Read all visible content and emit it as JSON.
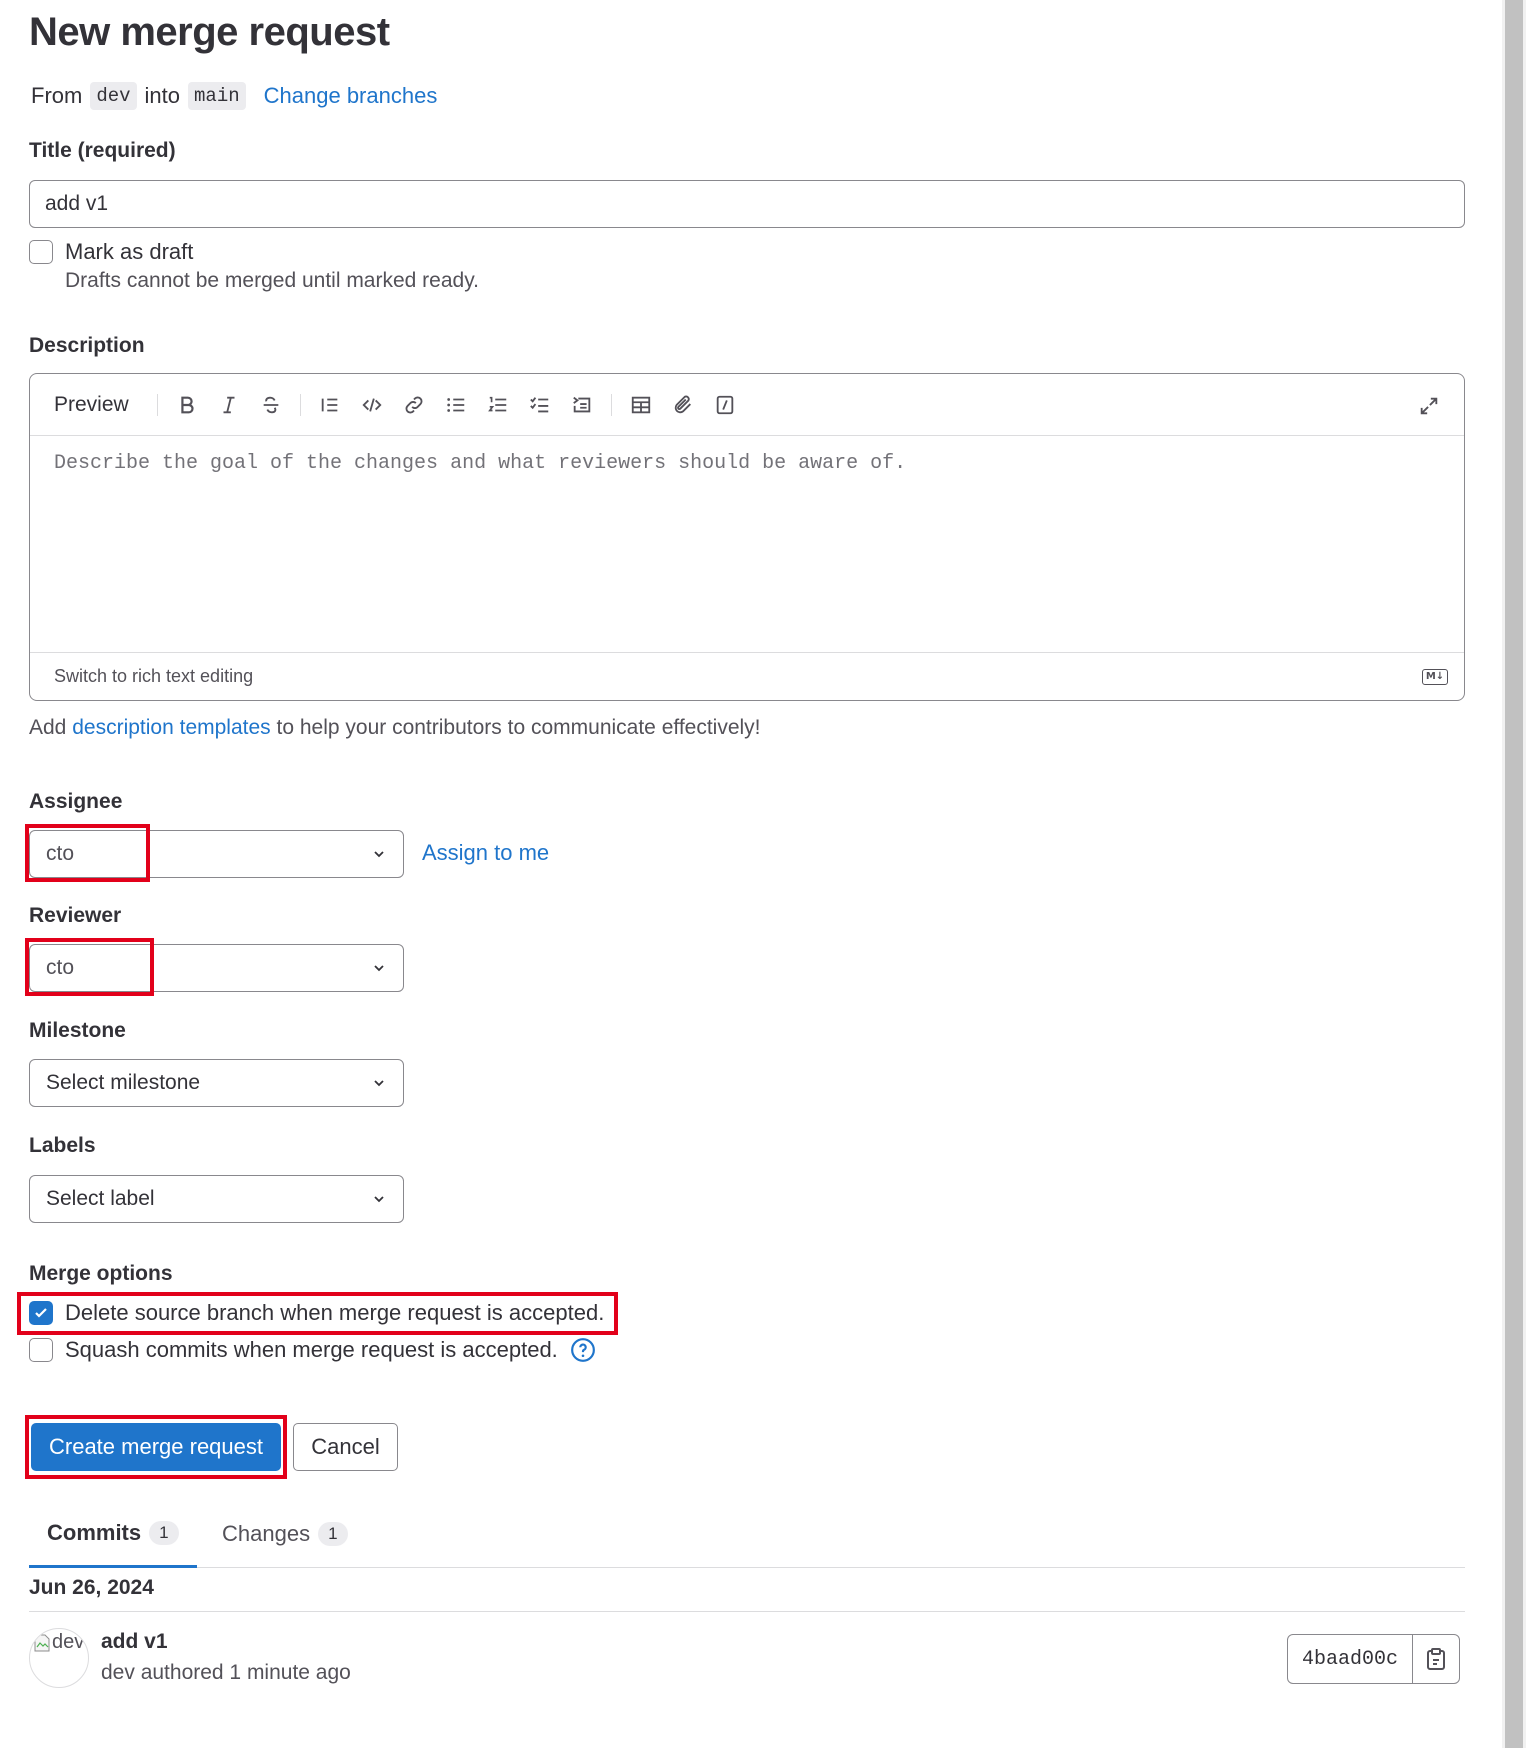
{
  "page": {
    "title": "New merge request"
  },
  "branches": {
    "from_label": "From",
    "source": "dev",
    "into_label": "into",
    "target": "main",
    "change_link": "Change branches"
  },
  "title_field": {
    "label": "Title (required)",
    "value": "add v1"
  },
  "draft": {
    "label": "Mark as draft",
    "help": "Drafts cannot be merged until marked ready.",
    "checked": false
  },
  "description": {
    "label": "Description",
    "preview_label": "Preview",
    "placeholder": "Describe the goal of the changes and what reviewers should be aware of.",
    "switch_label": "Switch to rich text editing",
    "toolbar_icons": [
      "bold-icon",
      "italic-icon",
      "strikethrough-icon",
      "quote-icon",
      "code-icon",
      "link-icon",
      "bullet-list-icon",
      "numbered-list-icon",
      "task-list-icon",
      "collapsible-icon",
      "table-icon",
      "attach-icon",
      "slash-command-icon",
      "fullscreen-icon"
    ],
    "markdown_badge": "M↓"
  },
  "templates": {
    "prefix": "Add",
    "link": "description templates",
    "suffix": "to help your contributors to communicate effectively!"
  },
  "assignee": {
    "label": "Assignee",
    "value": "cto",
    "assign_link": "Assign to me"
  },
  "reviewer": {
    "label": "Reviewer",
    "value": "cto"
  },
  "milestone": {
    "label": "Milestone",
    "placeholder": "Select milestone"
  },
  "labels": {
    "label": "Labels",
    "placeholder": "Select label"
  },
  "merge_options": {
    "label": "Merge options",
    "delete_branch": {
      "label": "Delete source branch when merge request is accepted.",
      "checked": true
    },
    "squash": {
      "label": "Squash commits when merge request is accepted.",
      "checked": false
    }
  },
  "actions": {
    "create": "Create merge request",
    "cancel": "Cancel"
  },
  "tabs": [
    {
      "label": "Commits",
      "count": "1",
      "active": true
    },
    {
      "label": "Changes",
      "count": "1",
      "active": false
    }
  ],
  "commits": {
    "date": "Jun 26, 2024",
    "items": [
      {
        "avatar_alt": "dev",
        "title": "add v1",
        "meta": "dev authored 1 minute ago",
        "sha": "4baad00c"
      }
    ]
  },
  "colors": {
    "accent": "#1f75cb",
    "highlight": "#e2001a"
  }
}
